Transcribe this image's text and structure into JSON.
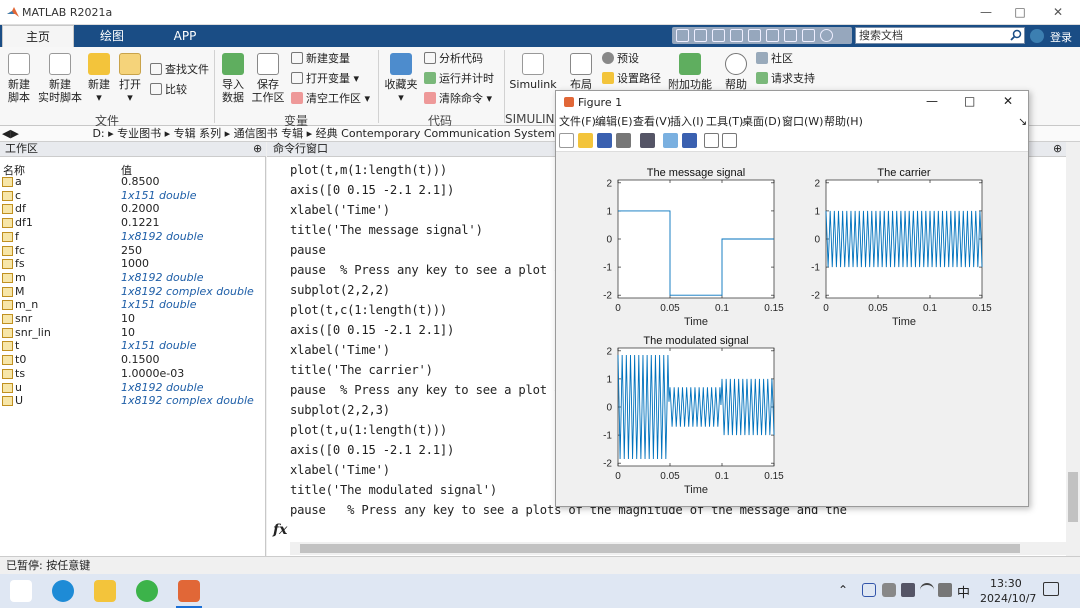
{
  "window": {
    "title": "MATLAB R2021a"
  },
  "tabs": [
    "主页",
    "绘图",
    "APP"
  ],
  "search": {
    "placeholder": "搜索文档"
  },
  "login_label": "登录",
  "ribbon": {
    "file_new_script": [
      "新建",
      "脚本"
    ],
    "file_new_live": [
      "新建",
      "实时脚本"
    ],
    "file_new": "新建",
    "file_open": "打开",
    "file_find": "查找文件",
    "file_compare": "比较",
    "var_import": [
      "导入",
      "数据"
    ],
    "var_save": [
      "保存",
      "工作区"
    ],
    "var_new": "新建变量",
    "var_open": "打开变量",
    "var_clear": "清空工作区",
    "code_fav": "收藏夹",
    "code_analyze": "分析代码",
    "code_run_time": "运行并计时",
    "code_clear": "清除命令",
    "simulink_label": "Simulink",
    "env_layout": "布局",
    "env_prefs": "预设",
    "env_path": "设置路径",
    "env_addons": "附加功能",
    "help": "帮助",
    "community": "社区",
    "support": "请求支持",
    "sections": {
      "file": "文件",
      "variable": "变量",
      "code": "代码",
      "simulink": "SIMULINK"
    }
  },
  "address": "D: ▸ 专业图书 ▸ 专辑 系列 ▸ 通信图书 专辑 ▸ 经典 Contemporary Communication Systems usin",
  "workspace": {
    "title": "工作区",
    "col_name": "名称",
    "col_value": "值",
    "vars": [
      {
        "name": "a",
        "value": "0.8500",
        "italic": false
      },
      {
        "name": "c",
        "value": "1x151 double",
        "italic": true
      },
      {
        "name": "df",
        "value": "0.2000",
        "italic": false
      },
      {
        "name": "df1",
        "value": "0.1221",
        "italic": false
      },
      {
        "name": "f",
        "value": "1x8192 double",
        "italic": true
      },
      {
        "name": "fc",
        "value": "250",
        "italic": false
      },
      {
        "name": "fs",
        "value": "1000",
        "italic": false
      },
      {
        "name": "m",
        "value": "1x8192 double",
        "italic": true
      },
      {
        "name": "M",
        "value": "1x8192 complex double",
        "italic": true
      },
      {
        "name": "m_n",
        "value": "1x151 double",
        "italic": true
      },
      {
        "name": "snr",
        "value": "10",
        "italic": false
      },
      {
        "name": "snr_lin",
        "value": "10",
        "italic": false
      },
      {
        "name": "t",
        "value": "1x151 double",
        "italic": true
      },
      {
        "name": "t0",
        "value": "0.1500",
        "italic": false
      },
      {
        "name": "ts",
        "value": "1.0000e-03",
        "italic": false
      },
      {
        "name": "u",
        "value": "1x8192 double",
        "italic": true
      },
      {
        "name": "U",
        "value": "1x8192 complex double",
        "italic": true
      }
    ]
  },
  "command_window": {
    "title": "命令行窗口",
    "lines": [
      "plot(t,m(1:length(t)))",
      "axis([0 0.15 -2.1 2.1])",
      "xlabel('Time')",
      "title('The message signal')",
      "pause",
      "pause  % Press any key to see a plot of",
      "subplot(2,2,2)",
      "plot(t,c(1:length(t)))",
      "axis([0 0.15 -2.1 2.1])",
      "xlabel('Time')",
      "title('The carrier')",
      "pause  % Press any key to see a plot of",
      "subplot(2,2,3)",
      "plot(t,u(1:length(t)))",
      "axis([0 0.15 -2.1 2.1])",
      "xlabel('Time')",
      "title('The modulated signal')",
      "pause   % Press any key to see a plots of the magnitude of the message and the"
    ],
    "prompt": "fx"
  },
  "figure": {
    "title": "Figure 1",
    "menu": [
      "文件(F)",
      "编辑(E)",
      "查看(V)",
      "插入(I)",
      "工具(T)",
      "桌面(D)",
      "窗口(W)",
      "帮助(H)"
    ]
  },
  "status": "已暂停: 按任意键",
  "taskbar": {
    "time": "13:30",
    "date": "2024/10/7",
    "ime": "中"
  },
  "chart_data": [
    {
      "type": "line",
      "title": "The message signal",
      "xlabel": "Time",
      "xlim": [
        0,
        0.15
      ],
      "ylim": [
        -2.1,
        2.1
      ],
      "xticks": [
        0,
        0.05,
        0.1,
        0.15
      ],
      "yticks": [
        -2,
        -1,
        0,
        1,
        2
      ],
      "x": [
        0,
        0.05,
        0.05,
        0.1,
        0.1,
        0.15
      ],
      "y": [
        1,
        1,
        -2,
        -2,
        0,
        0
      ]
    },
    {
      "type": "line",
      "title": "The carrier",
      "xlabel": "Time",
      "xlim": [
        0,
        0.15
      ],
      "ylim": [
        -2.1,
        2.1
      ],
      "xticks": [
        0,
        0.05,
        0.1,
        0.15
      ],
      "yticks": [
        -2,
        -1,
        0,
        1,
        2
      ],
      "signal": "cos(2*pi*250*t), sampled at 1000 Hz, t = 0..0.15"
    },
    {
      "type": "line",
      "title": "The modulated signal",
      "xlabel": "Time",
      "xlim": [
        0,
        0.15
      ],
      "ylim": [
        -2.1,
        2.1
      ],
      "xticks": [
        0,
        0.05,
        0.1,
        0.15
      ],
      "yticks": [
        -2,
        -1,
        0,
        1,
        2
      ],
      "signal": "(1 + 0.85*m) * carrier"
    }
  ],
  "colors": {
    "ribbon_tab_bg": "#1a4d85",
    "plot_line": "#0072bd",
    "italic_value": "#1f5fa8"
  }
}
